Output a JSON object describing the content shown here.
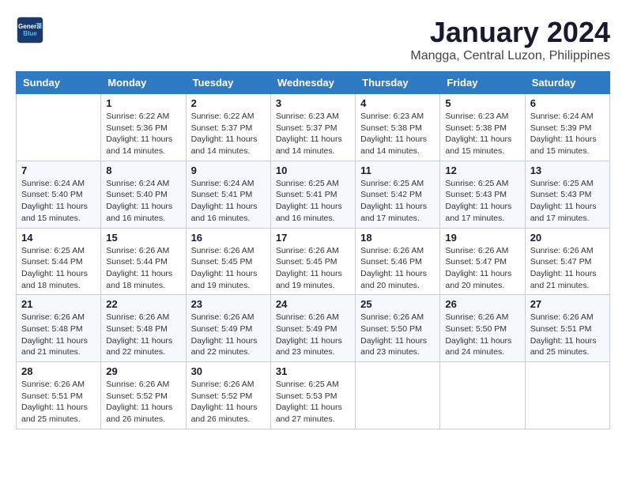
{
  "logo": {
    "line1": "General",
    "line2": "Blue"
  },
  "title": "January 2024",
  "subtitle": "Mangga, Central Luzon, Philippines",
  "weekdays": [
    "Sunday",
    "Monday",
    "Tuesday",
    "Wednesday",
    "Thursday",
    "Friday",
    "Saturday"
  ],
  "weeks": [
    [
      {
        "day": "",
        "sunrise": "",
        "sunset": "",
        "daylight": ""
      },
      {
        "day": "1",
        "sunrise": "Sunrise: 6:22 AM",
        "sunset": "Sunset: 5:36 PM",
        "daylight": "Daylight: 11 hours and 14 minutes."
      },
      {
        "day": "2",
        "sunrise": "Sunrise: 6:22 AM",
        "sunset": "Sunset: 5:37 PM",
        "daylight": "Daylight: 11 hours and 14 minutes."
      },
      {
        "day": "3",
        "sunrise": "Sunrise: 6:23 AM",
        "sunset": "Sunset: 5:37 PM",
        "daylight": "Daylight: 11 hours and 14 minutes."
      },
      {
        "day": "4",
        "sunrise": "Sunrise: 6:23 AM",
        "sunset": "Sunset: 5:38 PM",
        "daylight": "Daylight: 11 hours and 14 minutes."
      },
      {
        "day": "5",
        "sunrise": "Sunrise: 6:23 AM",
        "sunset": "Sunset: 5:38 PM",
        "daylight": "Daylight: 11 hours and 15 minutes."
      },
      {
        "day": "6",
        "sunrise": "Sunrise: 6:24 AM",
        "sunset": "Sunset: 5:39 PM",
        "daylight": "Daylight: 11 hours and 15 minutes."
      }
    ],
    [
      {
        "day": "7",
        "sunrise": "Sunrise: 6:24 AM",
        "sunset": "Sunset: 5:40 PM",
        "daylight": "Daylight: 11 hours and 15 minutes."
      },
      {
        "day": "8",
        "sunrise": "Sunrise: 6:24 AM",
        "sunset": "Sunset: 5:40 PM",
        "daylight": "Daylight: 11 hours and 16 minutes."
      },
      {
        "day": "9",
        "sunrise": "Sunrise: 6:24 AM",
        "sunset": "Sunset: 5:41 PM",
        "daylight": "Daylight: 11 hours and 16 minutes."
      },
      {
        "day": "10",
        "sunrise": "Sunrise: 6:25 AM",
        "sunset": "Sunset: 5:41 PM",
        "daylight": "Daylight: 11 hours and 16 minutes."
      },
      {
        "day": "11",
        "sunrise": "Sunrise: 6:25 AM",
        "sunset": "Sunset: 5:42 PM",
        "daylight": "Daylight: 11 hours and 17 minutes."
      },
      {
        "day": "12",
        "sunrise": "Sunrise: 6:25 AM",
        "sunset": "Sunset: 5:43 PM",
        "daylight": "Daylight: 11 hours and 17 minutes."
      },
      {
        "day": "13",
        "sunrise": "Sunrise: 6:25 AM",
        "sunset": "Sunset: 5:43 PM",
        "daylight": "Daylight: 11 hours and 17 minutes."
      }
    ],
    [
      {
        "day": "14",
        "sunrise": "Sunrise: 6:25 AM",
        "sunset": "Sunset: 5:44 PM",
        "daylight": "Daylight: 11 hours and 18 minutes."
      },
      {
        "day": "15",
        "sunrise": "Sunrise: 6:26 AM",
        "sunset": "Sunset: 5:44 PM",
        "daylight": "Daylight: 11 hours and 18 minutes."
      },
      {
        "day": "16",
        "sunrise": "Sunrise: 6:26 AM",
        "sunset": "Sunset: 5:45 PM",
        "daylight": "Daylight: 11 hours and 19 minutes."
      },
      {
        "day": "17",
        "sunrise": "Sunrise: 6:26 AM",
        "sunset": "Sunset: 5:45 PM",
        "daylight": "Daylight: 11 hours and 19 minutes."
      },
      {
        "day": "18",
        "sunrise": "Sunrise: 6:26 AM",
        "sunset": "Sunset: 5:46 PM",
        "daylight": "Daylight: 11 hours and 20 minutes."
      },
      {
        "day": "19",
        "sunrise": "Sunrise: 6:26 AM",
        "sunset": "Sunset: 5:47 PM",
        "daylight": "Daylight: 11 hours and 20 minutes."
      },
      {
        "day": "20",
        "sunrise": "Sunrise: 6:26 AM",
        "sunset": "Sunset: 5:47 PM",
        "daylight": "Daylight: 11 hours and 21 minutes."
      }
    ],
    [
      {
        "day": "21",
        "sunrise": "Sunrise: 6:26 AM",
        "sunset": "Sunset: 5:48 PM",
        "daylight": "Daylight: 11 hours and 21 minutes."
      },
      {
        "day": "22",
        "sunrise": "Sunrise: 6:26 AM",
        "sunset": "Sunset: 5:48 PM",
        "daylight": "Daylight: 11 hours and 22 minutes."
      },
      {
        "day": "23",
        "sunrise": "Sunrise: 6:26 AM",
        "sunset": "Sunset: 5:49 PM",
        "daylight": "Daylight: 11 hours and 22 minutes."
      },
      {
        "day": "24",
        "sunrise": "Sunrise: 6:26 AM",
        "sunset": "Sunset: 5:49 PM",
        "daylight": "Daylight: 11 hours and 23 minutes."
      },
      {
        "day": "25",
        "sunrise": "Sunrise: 6:26 AM",
        "sunset": "Sunset: 5:50 PM",
        "daylight": "Daylight: 11 hours and 23 minutes."
      },
      {
        "day": "26",
        "sunrise": "Sunrise: 6:26 AM",
        "sunset": "Sunset: 5:50 PM",
        "daylight": "Daylight: 11 hours and 24 minutes."
      },
      {
        "day": "27",
        "sunrise": "Sunrise: 6:26 AM",
        "sunset": "Sunset: 5:51 PM",
        "daylight": "Daylight: 11 hours and 25 minutes."
      }
    ],
    [
      {
        "day": "28",
        "sunrise": "Sunrise: 6:26 AM",
        "sunset": "Sunset: 5:51 PM",
        "daylight": "Daylight: 11 hours and 25 minutes."
      },
      {
        "day": "29",
        "sunrise": "Sunrise: 6:26 AM",
        "sunset": "Sunset: 5:52 PM",
        "daylight": "Daylight: 11 hours and 26 minutes."
      },
      {
        "day": "30",
        "sunrise": "Sunrise: 6:26 AM",
        "sunset": "Sunset: 5:52 PM",
        "daylight": "Daylight: 11 hours and 26 minutes."
      },
      {
        "day": "31",
        "sunrise": "Sunrise: 6:25 AM",
        "sunset": "Sunset: 5:53 PM",
        "daylight": "Daylight: 11 hours and 27 minutes."
      },
      {
        "day": "",
        "sunrise": "",
        "sunset": "",
        "daylight": ""
      },
      {
        "day": "",
        "sunrise": "",
        "sunset": "",
        "daylight": ""
      },
      {
        "day": "",
        "sunrise": "",
        "sunset": "",
        "daylight": ""
      }
    ]
  ]
}
